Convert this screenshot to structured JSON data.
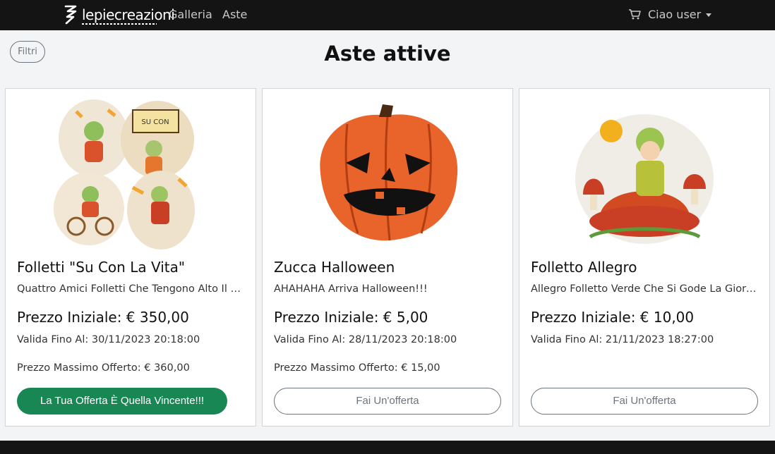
{
  "navbar": {
    "brand": "lepiecreazioni",
    "links": [
      "Galleria",
      "Aste"
    ],
    "user_menu": "Ciao user"
  },
  "filter_label": "Filtri",
  "page_title": "Aste attive",
  "cards": [
    {
      "title": "Folletti \"Su Con La Vita\"",
      "description": "Quattro Amici Folletti Che Tengono Alto Il Morale",
      "price": "Prezzo Iniziale: € 350,00",
      "valid_until": "Valida Fino Al: 30/11/2023 20:18:00",
      "max_offer": "Prezzo Massimo Offerto: € 360,00",
      "button": "La Tua Offerta È Quella Vincente!!!"
    },
    {
      "title": "Zucca Halloween",
      "description": "AHAHAHA Arriva Halloween!!!",
      "price": "Prezzo Iniziale: € 5,00",
      "valid_until": "Valida Fino Al: 28/11/2023 20:18:00",
      "max_offer": "Prezzo Massimo Offerto: € 15,00",
      "button": "Fai Un'offerta"
    },
    {
      "title": "Folletto Allegro",
      "description": "Allegro Folletto Verde Che Si Gode La Giornata",
      "price": "Prezzo Iniziale: € 10,00",
      "valid_until": "Valida Fino Al: 21/11/2023 18:27:00",
      "max_offer": "",
      "button": "Fai Un'offerta"
    }
  ],
  "colors": {
    "navbar": "#141414",
    "success": "#198754",
    "secondary": "#6c757d"
  }
}
